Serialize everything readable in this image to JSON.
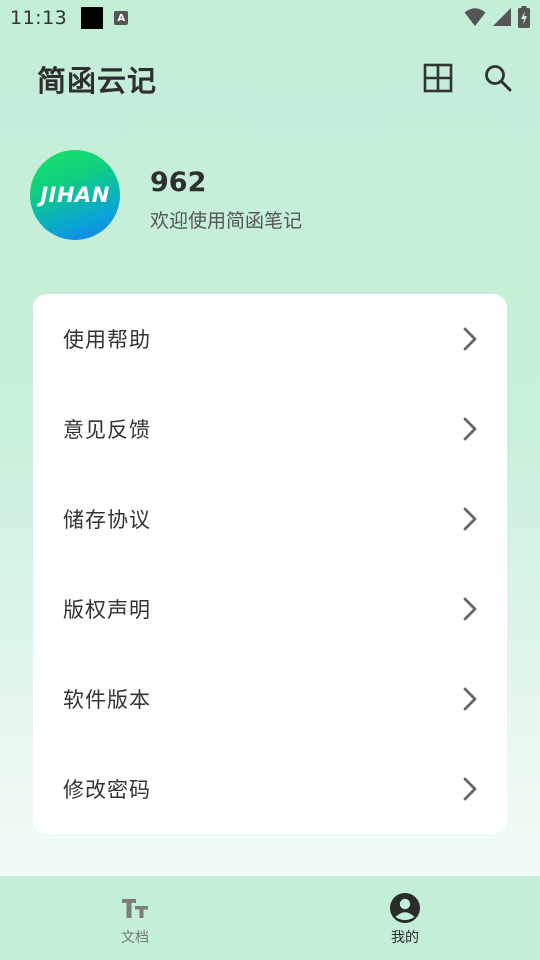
{
  "status_bar": {
    "time": "11:13",
    "notif_letter": "A"
  },
  "app_bar": {
    "title": "简函云记",
    "icons": [
      "grid-icon",
      "search-icon"
    ]
  },
  "profile": {
    "avatar_text": "JIHAN",
    "name": "962",
    "welcome": "欢迎使用简函笔记"
  },
  "menu": {
    "items": [
      {
        "label": "使用帮助"
      },
      {
        "label": "意见反馈"
      },
      {
        "label": "储存协议"
      },
      {
        "label": "版权声明"
      },
      {
        "label": "软件版本"
      },
      {
        "label": "修改密码"
      }
    ]
  },
  "bottom_nav": {
    "items": [
      {
        "label": "文档",
        "icon": "text-size-icon",
        "active": false
      },
      {
        "label": "我的",
        "icon": "account-circle-icon",
        "active": true
      }
    ]
  },
  "colors": {
    "background": "#c3eed8",
    "card": "#ffffff",
    "text_primary": "#2f2f2f",
    "avatar_gradient_start": "#19e26b",
    "avatar_gradient_end": "#1b7bf0"
  }
}
